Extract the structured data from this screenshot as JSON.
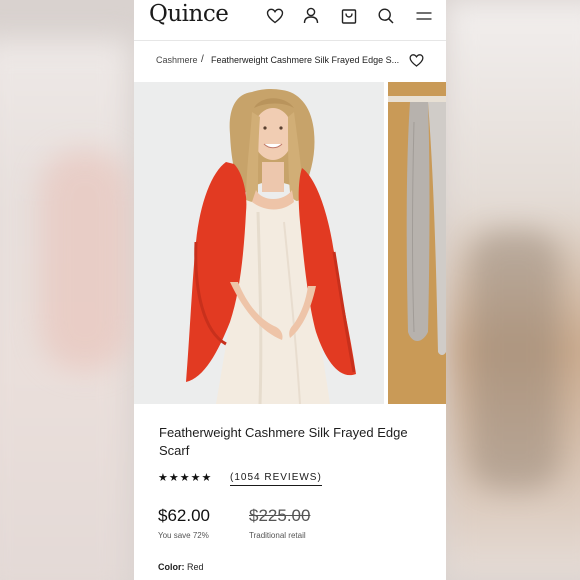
{
  "header": {
    "logo": "Quince",
    "icons": [
      "heart-icon",
      "user-icon",
      "bag-icon",
      "search-icon",
      "menu-icon"
    ]
  },
  "breadcrumb": {
    "parent": "Cashmere",
    "separator": "/",
    "current": "Featherweight Cashmere Silk Frayed Edge S..."
  },
  "product": {
    "title": "Featherweight Cashmere Silk Frayed Edge Scarf",
    "rating_stars": "★★★★★",
    "rating": 5,
    "reviews": "(1054 REVIEWS)",
    "price": "$62.00",
    "savings": "You save 72%",
    "original_price": "$225.00",
    "original_label": "Traditional retail",
    "color_label": "Color:",
    "color_value": "Red"
  },
  "colors": {
    "scarf": "#e23a22",
    "dress": "#f3ebe0",
    "second_image_bg": "#c99a57"
  }
}
